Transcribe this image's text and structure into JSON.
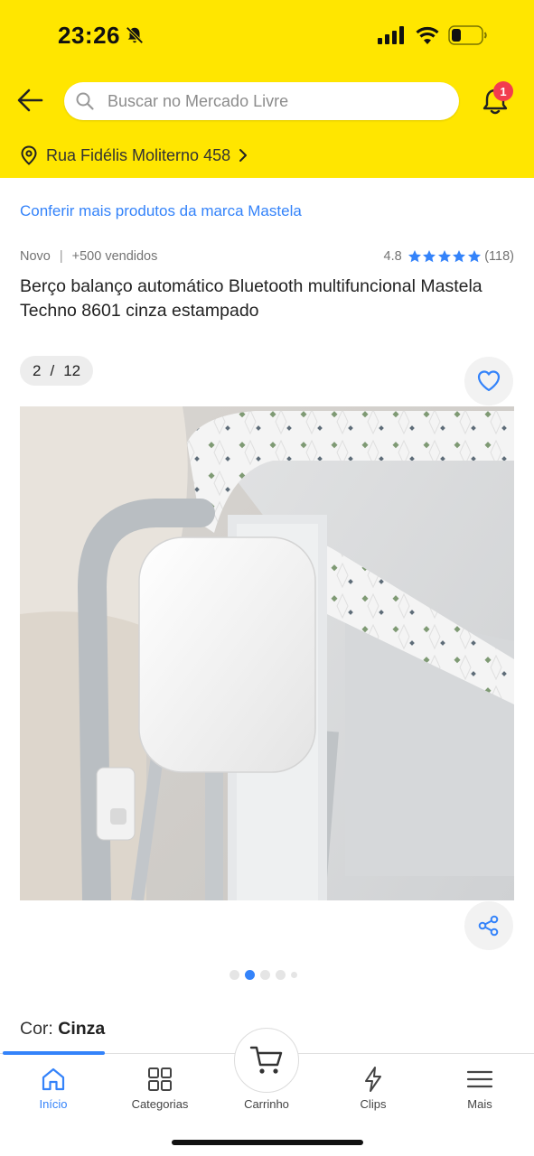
{
  "status_bar": {
    "time": "23:26",
    "icons": [
      "bell-off-icon",
      "signal-icon",
      "wifi-icon",
      "battery-icon"
    ]
  },
  "header": {
    "back_icon": "arrow-left-icon",
    "search": {
      "placeholder": "Buscar no Mercado Livre",
      "value": ""
    },
    "notifications": {
      "icon": "bell-icon",
      "badge_count": "1"
    },
    "address": {
      "label": "Rua Fidélis Moliterno 458"
    }
  },
  "product": {
    "brand_link": "Conferir mais produtos da marca Mastela",
    "condition": "Novo",
    "separator": "|",
    "sold": "+500 vendidos",
    "rating": {
      "value": "4.8",
      "stars": 5,
      "count": "(118)"
    },
    "title": "Berço balanço automático Bluetooth multifuncional Mastela Techno 8601 cinza estampado",
    "gallery": {
      "current": "2",
      "separator": "/",
      "total": "12",
      "active_dot": 2
    },
    "color": {
      "label": "Cor:",
      "value": "Cinza"
    }
  },
  "bottom_nav": {
    "items": [
      {
        "label": "Início",
        "icon": "home-icon",
        "active": true
      },
      {
        "label": "Categorias",
        "icon": "grid-icon",
        "active": false
      },
      {
        "label": "Carrinho",
        "icon": "cart-icon",
        "active": false
      },
      {
        "label": "Clips",
        "icon": "lightning-icon",
        "active": false
      },
      {
        "label": "Mais",
        "icon": "menu-icon",
        "active": false
      }
    ]
  },
  "colors": {
    "header_bg": "#ffe600",
    "link": "#3483fa",
    "badge": "#f23d4f",
    "star": "#3483fa"
  }
}
